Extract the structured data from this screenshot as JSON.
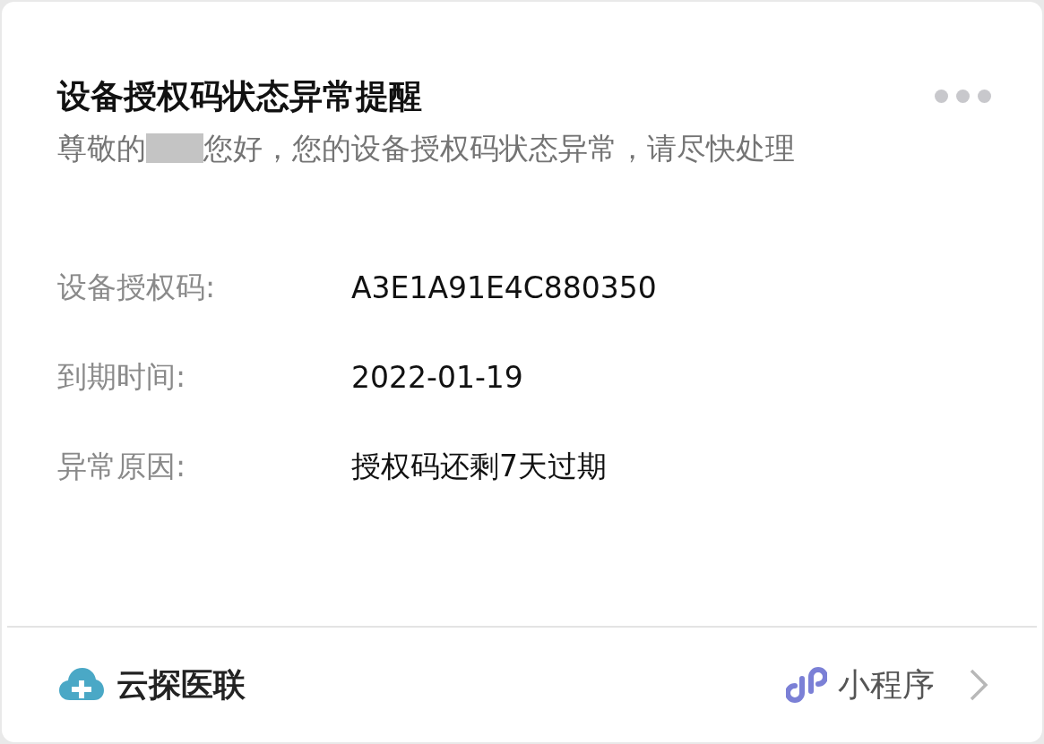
{
  "card": {
    "title": "设备授权码状态异常提醒",
    "greeting_prefix": "尊敬的",
    "greeting_rest": "您好，您的设备授权码状态异常，请尽快处理",
    "fields": [
      {
        "label": "设备授权码:",
        "value": "A3E1A91E4C880350"
      },
      {
        "label": "到期时间:",
        "value": "2022-01-19"
      },
      {
        "label": "异常原因:",
        "value": "授权码还剩7天过期"
      }
    ]
  },
  "footer": {
    "source": "云探医联",
    "link": "小程序"
  }
}
